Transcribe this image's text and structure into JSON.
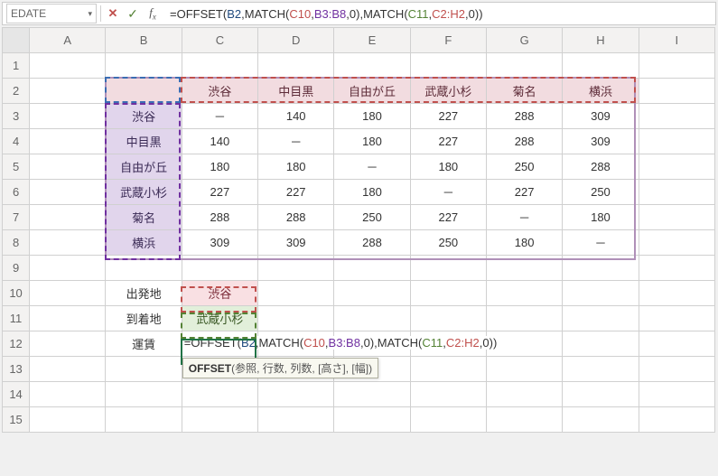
{
  "nameBox": {
    "value": "EDATE"
  },
  "formulaBar": {
    "prefix": "=OFFSET(",
    "b2": "B2",
    "comma": ",",
    "match": "MATCH(",
    "c10": "C10",
    "b3b8": "B3:B8",
    "zero": "0",
    "close": ")",
    "c11": "C11",
    "c2h2": "C2:H2",
    "finalClose": "))"
  },
  "columns": [
    "A",
    "B",
    "C",
    "D",
    "E",
    "F",
    "G",
    "H",
    "I"
  ],
  "rows": [
    "1",
    "2",
    "3",
    "4",
    "5",
    "6",
    "7",
    "8",
    "9",
    "10",
    "11",
    "12",
    "13",
    "14",
    "15"
  ],
  "stations": [
    "渋谷",
    "中目黒",
    "自由が丘",
    "武蔵小杉",
    "菊名",
    "横浜"
  ],
  "fareTable": [
    [
      "－",
      "140",
      "180",
      "227",
      "288",
      "309"
    ],
    [
      "140",
      "－",
      "180",
      "227",
      "288",
      "309"
    ],
    [
      "180",
      "180",
      "－",
      "180",
      "250",
      "288"
    ],
    [
      "227",
      "227",
      "180",
      "－",
      "227",
      "250"
    ],
    [
      "288",
      "288",
      "250",
      "227",
      "－",
      "180"
    ],
    [
      "309",
      "309",
      "288",
      "250",
      "180",
      "－"
    ]
  ],
  "labels": {
    "departure": "出発地",
    "arrival": "到着地",
    "fare": "運賃",
    "depValue": "渋谷",
    "arrValue": "武蔵小杉"
  },
  "tooltip": {
    "fn": "OFFSET",
    "args": "(参照, 行数, 列数, [高さ], [幅])"
  },
  "chart_data": {
    "type": "table",
    "title": "駅間運賃表",
    "categories": [
      "渋谷",
      "中目黒",
      "自由が丘",
      "武蔵小杉",
      "菊名",
      "横浜"
    ],
    "series": [
      {
        "name": "渋谷",
        "values": [
          null,
          140,
          180,
          227,
          288,
          309
        ]
      },
      {
        "name": "中目黒",
        "values": [
          140,
          null,
          180,
          227,
          288,
          309
        ]
      },
      {
        "name": "自由が丘",
        "values": [
          180,
          180,
          null,
          180,
          250,
          288
        ]
      },
      {
        "name": "武蔵小杉",
        "values": [
          227,
          227,
          180,
          null,
          227,
          250
        ]
      },
      {
        "name": "菊名",
        "values": [
          288,
          288,
          250,
          227,
          null,
          180
        ]
      },
      {
        "name": "横浜",
        "values": [
          309,
          309,
          288,
          250,
          180,
          null
        ]
      }
    ],
    "inputs": {
      "出発地": "渋谷",
      "到着地": "武蔵小杉"
    },
    "formula": "=OFFSET(B2,MATCH(C10,B3:B8,0),MATCH(C11,C2:H2,0))"
  }
}
